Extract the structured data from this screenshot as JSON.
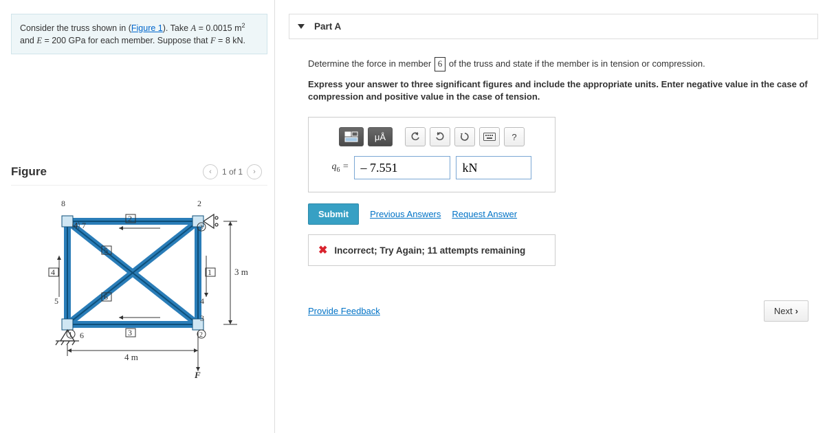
{
  "problem": {
    "pre": "Consider the truss shown in (",
    "figure_link": "Figure 1",
    "post_link": "). Take ",
    "A_label": "A",
    "A_val": " = 0.0015 m",
    "A_sup": "2",
    "and": " and ",
    "E_label": "E",
    "E_val": " = 200 GPa for each member. Suppose that ",
    "F_label": "F",
    "F_val": " = 8 kN."
  },
  "figure": {
    "title": "Figure",
    "pager": "1 of 1",
    "chevron_left": "‹",
    "chevron_right": "›"
  },
  "partA": {
    "label": "Part A",
    "question_pre": "Determine the force in member ",
    "member_box": "6",
    "question_post": " of the truss and state if the member is in tension or compression.",
    "instruction": "Express your answer to three significant figures and include the appropriate units. Enter negative value in the case of compression and positive value in the case of tension.",
    "lhs": "q",
    "lhs_sub": "6",
    "lhs_eq": " =",
    "value": "– 7.551",
    "units": "kN",
    "toolbar": {
      "units_glyph": "μÅ",
      "help": "?"
    },
    "submit": "Submit",
    "prev_answers": "Previous Answers",
    "request_answer": "Request Answer",
    "feedback": "Incorrect; Try Again; 11 attempts remaining"
  },
  "footer": {
    "feedback_link": "Provide Feedback",
    "next": "Next"
  },
  "chart_data": {
    "type": "diagram",
    "description": "Rectangular truss 4 m wide × 3 m tall with two diagonals forming an X. Nodes numbered 1–4, members labeled 1–8, pin support bottom-left, roller bottom-right, downward force F at node 3 (bottom-right).",
    "width_m": 4,
    "height_m": 3,
    "members": [
      "1",
      "2",
      "3",
      "4",
      "5",
      "6",
      "7",
      "8"
    ],
    "force_label": "F",
    "dim_labels": [
      "3 m",
      "4 m"
    ]
  }
}
